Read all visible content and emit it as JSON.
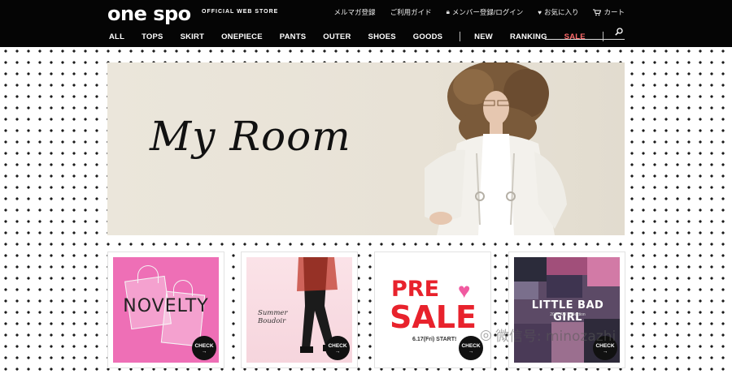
{
  "header": {
    "logo": "one spo",
    "tagline": "OFFICIAL WEB STORE",
    "util": [
      {
        "label": "メルマガ登録",
        "icon": ""
      },
      {
        "label": "ご利用ガイド",
        "icon": ""
      },
      {
        "label": "メンバー登録/ログイン",
        "icon": "lock-icon"
      },
      {
        "label": "お気に入り",
        "icon": "heart-icon"
      },
      {
        "label": "カート",
        "icon": "cart-icon"
      }
    ],
    "nav": [
      "ALL",
      "TOPS",
      "SKIRT",
      "ONEPIECE",
      "PANTS",
      "OUTER",
      "SHOES",
      "GOODS"
    ],
    "nav2": [
      "NEW",
      "RANKING",
      "SALE"
    ],
    "search": {
      "value": "",
      "placeholder": ""
    }
  },
  "hero": {
    "title": "My Room"
  },
  "cards": [
    {
      "title": "NOVELTY",
      "check": "CHECK"
    },
    {
      "title": "Summer Boudoir",
      "line1": "Summer",
      "line2": "Boudoir",
      "check": "CHECK"
    },
    {
      "line1": "PRE",
      "line2": "SALE",
      "date": "6.17(Fri) START!",
      "check": "CHECK"
    },
    {
      "title": "LITTLE BAD GIRL",
      "sub": "2016 AW Collection",
      "check": "CHECK"
    }
  ],
  "watermark": "微信号: minozazhi",
  "colors": {
    "header_bg": "#050505",
    "sale": "#ff6a6a",
    "pink": "#ee6fb6",
    "red": "#e8222c"
  }
}
